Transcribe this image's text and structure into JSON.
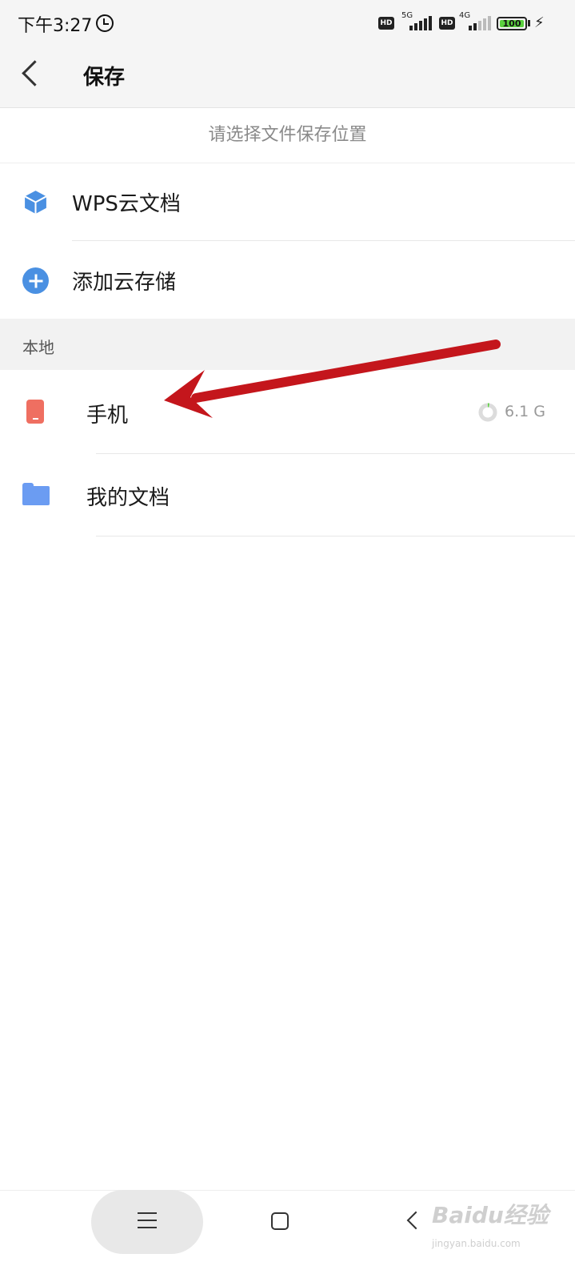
{
  "status_bar": {
    "time": "下午3:27",
    "net1": "5G",
    "net2": "4G",
    "hd": "HD",
    "battery": "100"
  },
  "header": {
    "title": "保存"
  },
  "hint": "请选择文件保存位置",
  "cloud": {
    "items": [
      {
        "label": "WPS云文档",
        "icon": "cube-icon"
      },
      {
        "label": "添加云存储",
        "icon": "plus-icon"
      }
    ]
  },
  "local": {
    "section_label": "本地",
    "items": [
      {
        "label": "手机",
        "icon": "phone-icon",
        "storage": "6.1 G"
      },
      {
        "label": "我的文档",
        "icon": "folder-icon"
      }
    ]
  },
  "colors": {
    "accent_blue": "#4a90e2",
    "phone_red": "#ef6f61",
    "folder_blue": "#6b9cf2",
    "annotation_arrow": "#c4161c"
  },
  "watermark": {
    "text": "Baidu经验",
    "sub": "jingyan.baidu.com"
  }
}
